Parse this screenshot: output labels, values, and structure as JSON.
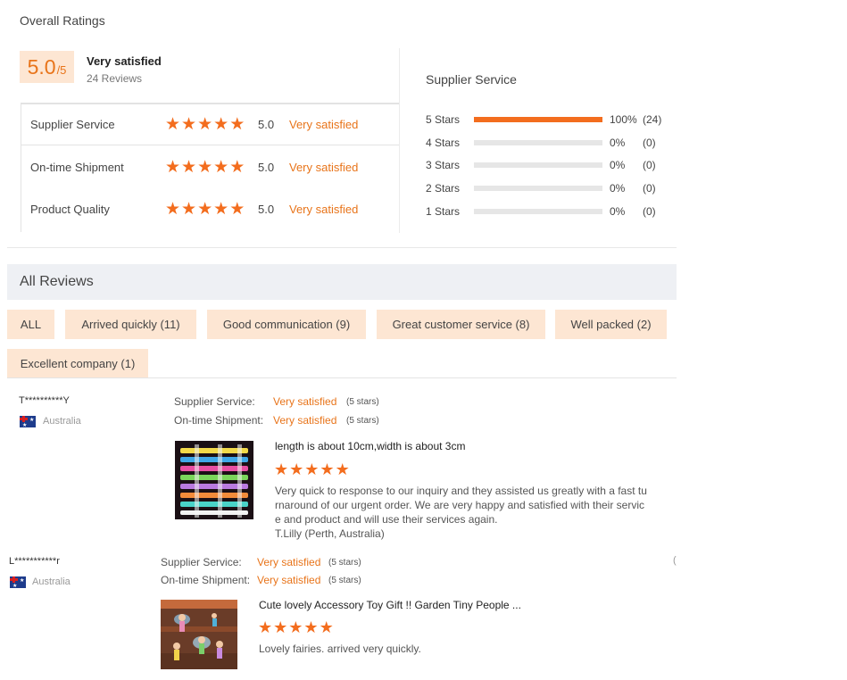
{
  "overall": {
    "title": "Overall Ratings",
    "score": "5.0",
    "score_suffix": "/5",
    "verdict": "Very satisfied",
    "reviews_count": "24 Reviews",
    "rows": [
      {
        "label": "Supplier Service",
        "stars": 5,
        "value": "5.0",
        "text": "Very satisfied"
      },
      {
        "label": "On-time Shipment",
        "stars": 5,
        "value": "5.0",
        "text": "Very satisfied"
      },
      {
        "label": "Product Quality",
        "stars": 5,
        "value": "5.0",
        "text": "Very satisfied"
      }
    ]
  },
  "distribution": {
    "title": "Supplier Service",
    "rows": [
      {
        "label": "5 Stars",
        "fraction": 1.0,
        "pct": "100%",
        "count": "(24)"
      },
      {
        "label": "4 Stars",
        "fraction": 0,
        "pct": "0%",
        "count": "(0)"
      },
      {
        "label": "3 Stars",
        "fraction": 0,
        "pct": "0%",
        "count": "(0)"
      },
      {
        "label": "2 Stars",
        "fraction": 0,
        "pct": "0%",
        "count": "(0)"
      },
      {
        "label": "1 Stars",
        "fraction": 0,
        "pct": "0%",
        "count": "(0)"
      }
    ]
  },
  "all_reviews": {
    "title": "All Reviews",
    "tags": [
      "ALL",
      "Arrived quickly (11)",
      "Good communication (9)",
      "Great customer service (8)",
      "Well packed (2)",
      "Excellent company (1)"
    ]
  },
  "reviews": [
    {
      "user": "T**********Y",
      "country": "Australia",
      "supplier_label": "Supplier Service:",
      "supplier_value": "Very satisfied",
      "supplier_stars": "(5 stars)",
      "shipment_label": "On-time Shipment:",
      "shipment_value": "Very satisfied",
      "shipment_stars": "(5 stars)",
      "product_title": "length is about 10cm,width is about 3cm",
      "rating": 5,
      "body_lines": [
        "Very quick to response to our inquiry and they assisted us greatly with a fast tu",
        "rnaround of our urgent order.  We are very happy and satisfied with their servic",
        "e and product and will use their services again.",
        "T.Lilly (Perth, Australia)"
      ]
    },
    {
      "user": "L***********r",
      "country": "Australia",
      "supplier_label": "Supplier Service:",
      "supplier_value": "Very satisfied",
      "supplier_stars": "(5 stars)",
      "shipment_label": "On-time Shipment:",
      "shipment_value": "Very satisfied",
      "shipment_stars": "(5 stars)",
      "product_title": "Cute lovely Accessory Toy Gift !! Garden Tiny People ...",
      "rating": 5,
      "body_lines": [
        "Lovely fairies. arrived very quickly."
      ]
    }
  ],
  "star_glyph": "★",
  "colors": {
    "accent": "#f36d1e",
    "tag_bg": "#fde6d3",
    "header_bg": "#eef0f4"
  }
}
